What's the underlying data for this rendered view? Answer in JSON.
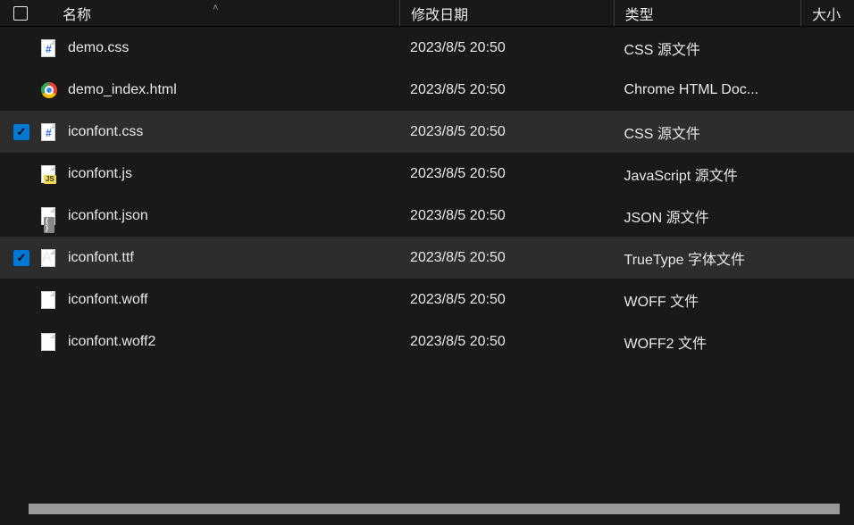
{
  "columns": {
    "name": "名称",
    "date": "修改日期",
    "type": "类型",
    "size": "大小"
  },
  "files": [
    {
      "icon": "css",
      "name": "demo.css",
      "date": "2023/8/5 20:50",
      "type": "CSS 源文件",
      "selected": false
    },
    {
      "icon": "chrome",
      "name": "demo_index.html",
      "date": "2023/8/5 20:50",
      "type": "Chrome HTML Doc...",
      "selected": false
    },
    {
      "icon": "css",
      "name": "iconfont.css",
      "date": "2023/8/5 20:50",
      "type": "CSS 源文件",
      "selected": true
    },
    {
      "icon": "js",
      "name": "iconfont.js",
      "date": "2023/8/5 20:50",
      "type": "JavaScript 源文件",
      "selected": false
    },
    {
      "icon": "json",
      "name": "iconfont.json",
      "date": "2023/8/5 20:50",
      "type": "JSON 源文件",
      "selected": false
    },
    {
      "icon": "ttf",
      "name": "iconfont.ttf",
      "date": "2023/8/5 20:50",
      "type": "TrueType 字体文件",
      "selected": true
    },
    {
      "icon": "generic",
      "name": "iconfont.woff",
      "date": "2023/8/5 20:50",
      "type": "WOFF 文件",
      "selected": false
    },
    {
      "icon": "generic",
      "name": "iconfont.woff2",
      "date": "2023/8/5 20:50",
      "type": "WOFF2 文件",
      "selected": false
    }
  ]
}
